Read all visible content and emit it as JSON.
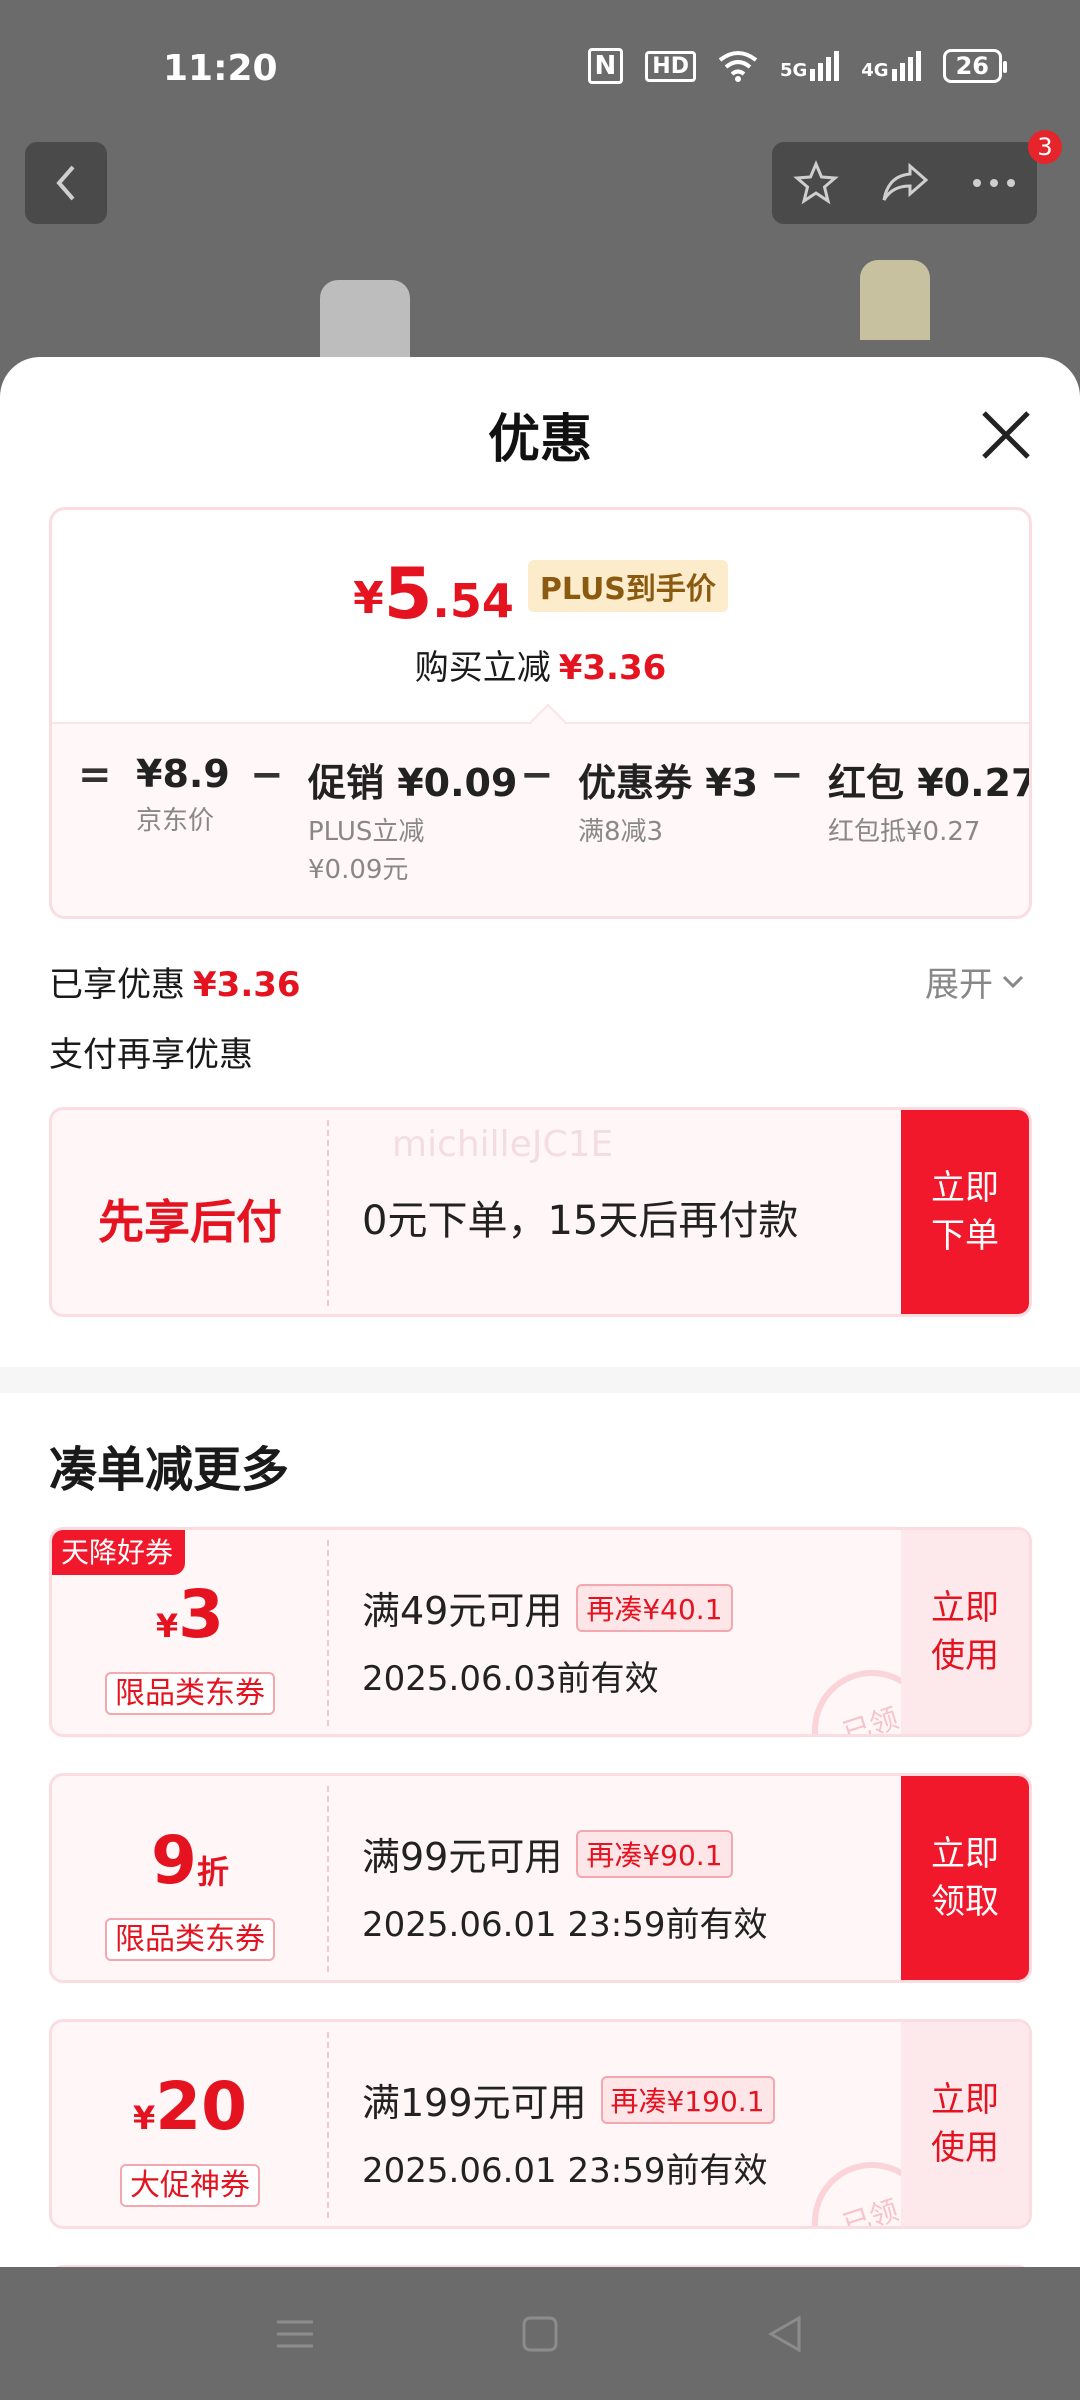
{
  "status": {
    "time": "11:20",
    "nfc": "N",
    "hd": "HD",
    "net1": "5G",
    "net2": "4G",
    "battery": "26"
  },
  "header": {
    "badge_count": "3"
  },
  "sheet": {
    "title": "优惠",
    "price": {
      "currency": "¥",
      "integer": "5",
      "decimal": ".54",
      "tag": "PLUS到手价"
    },
    "instant": {
      "label": "购买立减",
      "amount": "¥3.36"
    },
    "formula": {
      "equals": "=",
      "minus": "−",
      "base": {
        "value": "¥8.9",
        "desc": "京东价"
      },
      "promo": {
        "value": "促销 ¥0.09",
        "desc1": "PLUS立减",
        "desc2": "¥0.09元"
      },
      "coupon": {
        "value": "优惠券 ¥3",
        "desc": "满8减3"
      },
      "redpacket": {
        "value": "红包 ¥0.27",
        "desc": "红包抵¥0.27"
      }
    },
    "enjoyed": {
      "label": "已享优惠",
      "amount": "¥3.36"
    },
    "expand_label": "展开",
    "pay_more_label": "支付再享优惠",
    "bnpl": {
      "title": "先享后付",
      "desc": "0元下单，15天后再付款",
      "action": "立即下单",
      "watermark": "michilleJC1E"
    },
    "more_section_title": "凑单减更多",
    "coupons": [
      {
        "corner": "天降好券",
        "currency": "¥",
        "amount": "3",
        "unit": "",
        "category": "限品类东券",
        "condition": "满49元可用",
        "more": "再凑¥40.1",
        "valid": "2025.06.03前有效",
        "action": "立即使用",
        "stamp": "已领"
      },
      {
        "corner": "",
        "currency": "",
        "amount": "9",
        "unit": "折",
        "category": "限品类东券",
        "condition": "满99元可用",
        "more": "再凑¥90.1",
        "valid": "2025.06.01 23:59前有效",
        "action": "立即领取",
        "stamp": ""
      },
      {
        "corner": "",
        "currency": "¥",
        "amount": "20",
        "unit": "",
        "category": "大促神券",
        "condition": "满199元可用",
        "more": "再凑¥190.1",
        "valid": "2025.06.01 23:59前有效",
        "action": "立即使用",
        "stamp": "已领"
      }
    ]
  },
  "colors": {
    "accent": "#e4131f",
    "action_bg": "#f2182c",
    "plus_tag_bg": "#fdeccb"
  }
}
